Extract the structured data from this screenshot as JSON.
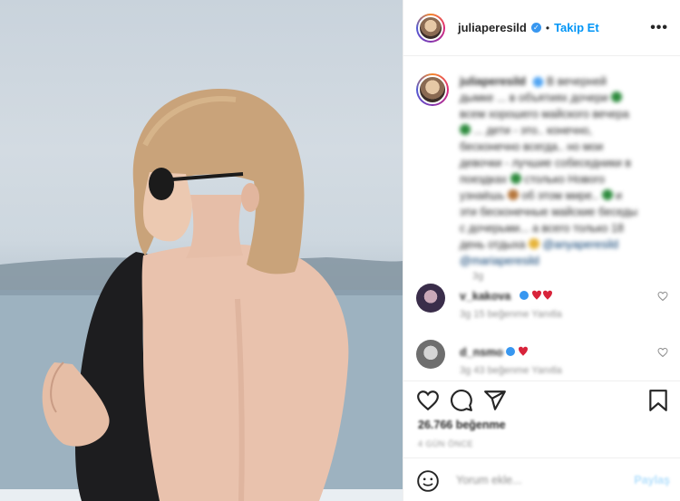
{
  "header": {
    "username": "juliaperesild",
    "separator": "•",
    "follow_label": "Takip Et",
    "more_label": "•••"
  },
  "caption": {
    "username": "juliaperesild",
    "text_part1": "В вечерней дымке ... в объятиях дочери",
    "text_part2": "всем хорошего майского вечера",
    "text_part3": "... дети - это.. конечно, бесконечно всегда.. но мои девочки - лучшие собеседники в поездках",
    "text_part4": "столько Нового узнаёшь",
    "text_part5": "об этом мире..",
    "text_part6": "и эти бесконечные майские беседы с дочерьми... а всего только 18 день отдыха",
    "mention1": "@anyaperesild",
    "mention2": "@mariaperesild",
    "time": "3g"
  },
  "comments": [
    {
      "username": "v_kakova",
      "meta": "3g   15 beğenme   Yanıtla",
      "avatar_color": "#3a2d4a"
    },
    {
      "username": "d_nsmo",
      "meta": "3g   43 beğenme   Yanıtla",
      "avatar_color": "#6e6e6e"
    }
  ],
  "actions": {
    "likes": "26.766 beğenme",
    "date": "4 GÜN ÖNCE"
  },
  "add_comment": {
    "placeholder": "Yorum ekle...",
    "share_label": "Paylaş"
  },
  "colors": {
    "accent": "#0095f6",
    "verified": "#3897f0",
    "heart_red": "#ed4956",
    "border": "#efefef"
  },
  "icons": [
    "heart-icon",
    "comment-icon",
    "share-icon",
    "bookmark-icon",
    "smile-icon",
    "verified-icon",
    "more-icon"
  ]
}
